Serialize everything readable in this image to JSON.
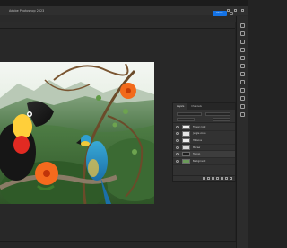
{
  "app": {
    "title": "Adobe Photoshop 2023",
    "share_label": "Share"
  },
  "document": {
    "description_icon": "tropical-birds-artwork"
  },
  "layers_panel": {
    "tabs": [
      {
        "label": "Layers"
      },
      {
        "label": "Channels"
      }
    ],
    "layers": [
      {
        "name": "Flower right",
        "thumb_color": "#f2f2f2"
      },
      {
        "name": "Jungle vines",
        "thumb_color": "#e6e6e6"
      },
      {
        "name": "Hibiscus",
        "thumb_color": "#eeeeee"
      },
      {
        "name": "Macaw",
        "thumb_color": "#d8d8d8"
      },
      {
        "name": "Toucan",
        "thumb_color": "#1e1e1e"
      },
      {
        "name": "Background",
        "thumb_color": "#6b9a5a"
      }
    ]
  },
  "colors": {
    "accent": "#1473e6",
    "panel_bg": "#323232",
    "app_bg": "#232323"
  }
}
